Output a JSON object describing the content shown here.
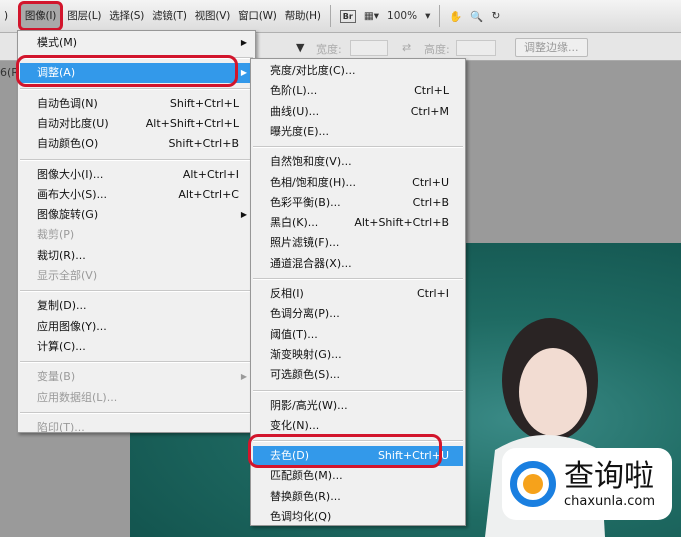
{
  "menubar": {
    "items": [
      "图像(I)",
      "图层(L)",
      "选择(S)",
      "滤镜(T)",
      "视图(V)",
      "窗口(W)",
      "帮助(H)"
    ],
    "br": "Br",
    "zoom": "100%",
    "zoom_arrow": "▾",
    "hand": "✋",
    "search": "🔍"
  },
  "options": {
    "width_label": "宽度:",
    "height_label": "高度:",
    "swap": "⇄",
    "refine": "调整边缘..."
  },
  "doc_tab": "6(R",
  "left_menu": [
    {
      "label": "模式(M)",
      "submenu": true
    },
    {
      "sep": true
    },
    {
      "label": "调整(A)",
      "submenu": true,
      "highlight": true
    },
    {
      "sep": true
    },
    {
      "label": "自动色调(N)",
      "shortcut": "Shift+Ctrl+L"
    },
    {
      "label": "自动对比度(U)",
      "shortcut": "Alt+Shift+Ctrl+L"
    },
    {
      "label": "自动颜色(O)",
      "shortcut": "Shift+Ctrl+B"
    },
    {
      "sep": true
    },
    {
      "label": "图像大小(I)...",
      "shortcut": "Alt+Ctrl+I"
    },
    {
      "label": "画布大小(S)...",
      "shortcut": "Alt+Ctrl+C"
    },
    {
      "label": "图像旋转(G)",
      "submenu": true
    },
    {
      "label": "裁剪(P)",
      "disabled": true
    },
    {
      "label": "裁切(R)..."
    },
    {
      "label": "显示全部(V)",
      "disabled": true
    },
    {
      "sep": true
    },
    {
      "label": "复制(D)..."
    },
    {
      "label": "应用图像(Y)..."
    },
    {
      "label": "计算(C)..."
    },
    {
      "sep": true
    },
    {
      "label": "变量(B)",
      "submenu": true,
      "disabled": true
    },
    {
      "label": "应用数据组(L)...",
      "disabled": true
    },
    {
      "sep": true
    },
    {
      "label": "陷印(T)...",
      "disabled": true
    }
  ],
  "sub_menu": [
    {
      "label": "亮度/对比度(C)..."
    },
    {
      "label": "色阶(L)...",
      "shortcut": "Ctrl+L"
    },
    {
      "label": "曲线(U)...",
      "shortcut": "Ctrl+M"
    },
    {
      "label": "曝光度(E)..."
    },
    {
      "sep": true
    },
    {
      "label": "自然饱和度(V)..."
    },
    {
      "label": "色相/饱和度(H)...",
      "shortcut": "Ctrl+U"
    },
    {
      "label": "色彩平衡(B)...",
      "shortcut": "Ctrl+B"
    },
    {
      "label": "黑白(K)...",
      "shortcut": "Alt+Shift+Ctrl+B"
    },
    {
      "label": "照片滤镜(F)..."
    },
    {
      "label": "通道混合器(X)..."
    },
    {
      "sep": true
    },
    {
      "label": "反相(I)",
      "shortcut": "Ctrl+I"
    },
    {
      "label": "色调分离(P)..."
    },
    {
      "label": "阈值(T)..."
    },
    {
      "label": "渐变映射(G)..."
    },
    {
      "label": "可选颜色(S)..."
    },
    {
      "sep": true
    },
    {
      "label": "阴影/高光(W)..."
    },
    {
      "label": "变化(N)..."
    },
    {
      "sep": true
    },
    {
      "label": "去色(D)",
      "shortcut": "Shift+Ctrl+U",
      "highlight": true
    },
    {
      "label": "匹配颜色(M)..."
    },
    {
      "label": "替换颜色(R)..."
    },
    {
      "label": "色调均化(Q)"
    }
  ],
  "watermark": {
    "name": "查询啦",
    "url": "chaxunla.com"
  }
}
